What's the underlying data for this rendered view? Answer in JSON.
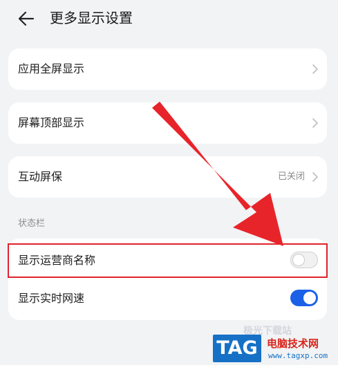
{
  "header": {
    "title": "更多显示设置"
  },
  "items": {
    "fullscreen": "应用全屏显示",
    "top_display": "屏幕顶部显示",
    "interactive_screensaver": "互动屏保",
    "interactive_screensaver_value": "已关闭"
  },
  "status_bar": {
    "section_title": "状态栏",
    "carrier_name": {
      "label": "显示运营商名称",
      "enabled": false
    },
    "network_speed": {
      "label": "显示实时网速",
      "enabled": true
    }
  },
  "colors": {
    "accent": "#1b61e8",
    "annotation": "#e0222a",
    "background": "#f1f3f5"
  },
  "watermark": {
    "site_text": "极光下载站",
    "logo_text": "TAG",
    "cn_text": "电脑技术网",
    "url": "www.tagxp.com"
  }
}
